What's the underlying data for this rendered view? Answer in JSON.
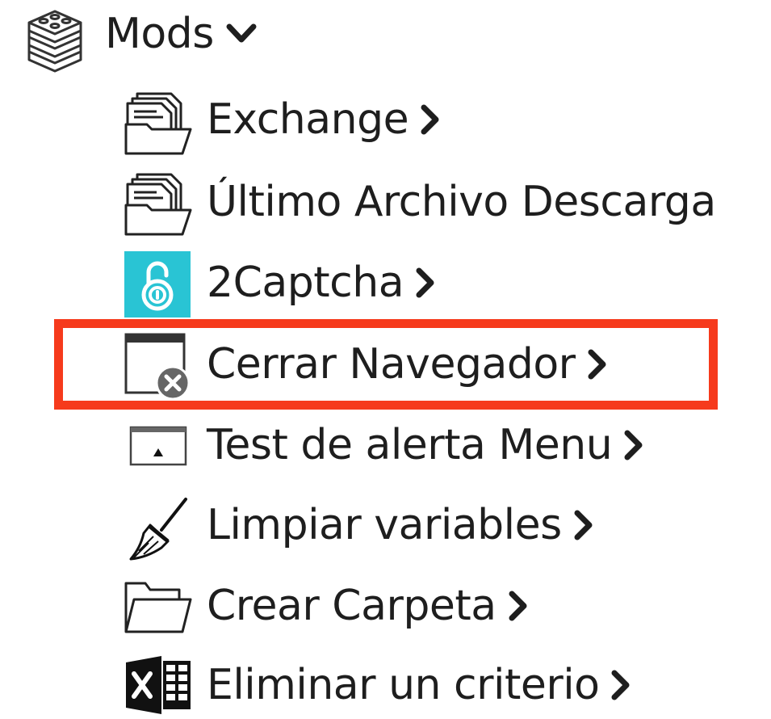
{
  "tree": {
    "header": {
      "label": "Mods",
      "icon": "blocks-stack-icon",
      "chevron": "chevron-down-icon"
    },
    "items": [
      {
        "label": "Exchange",
        "icon": "documents-folder-icon",
        "chevron": "chevron-right-icon"
      },
      {
        "label": "Último Archivo Descarga",
        "icon": "documents-folder-icon"
      },
      {
        "label": "2Captcha",
        "icon": "padlock-captcha-icon",
        "icon_color": "#29c4d4",
        "chevron": "chevron-right-icon"
      },
      {
        "label": "Cerrar Navegador",
        "icon": "browser-close-icon",
        "chevron": "chevron-right-icon",
        "highlighted": true
      },
      {
        "label": "Test de alerta Menu",
        "icon": "alert-window-icon",
        "chevron": "chevron-right-icon"
      },
      {
        "label": "Limpiar variables",
        "icon": "broom-icon",
        "chevron": "chevron-right-icon"
      },
      {
        "label": "Crear Carpeta",
        "icon": "folder-icon",
        "chevron": "chevron-right-icon"
      },
      {
        "label": "Eliminar un criterio",
        "icon": "excel-icon",
        "chevron": "chevron-right-icon"
      }
    ]
  },
  "colors": {
    "text": "#1e1e1e",
    "highlight_border": "#f63a1c",
    "captcha_icon_bg": "#29c4d4"
  }
}
